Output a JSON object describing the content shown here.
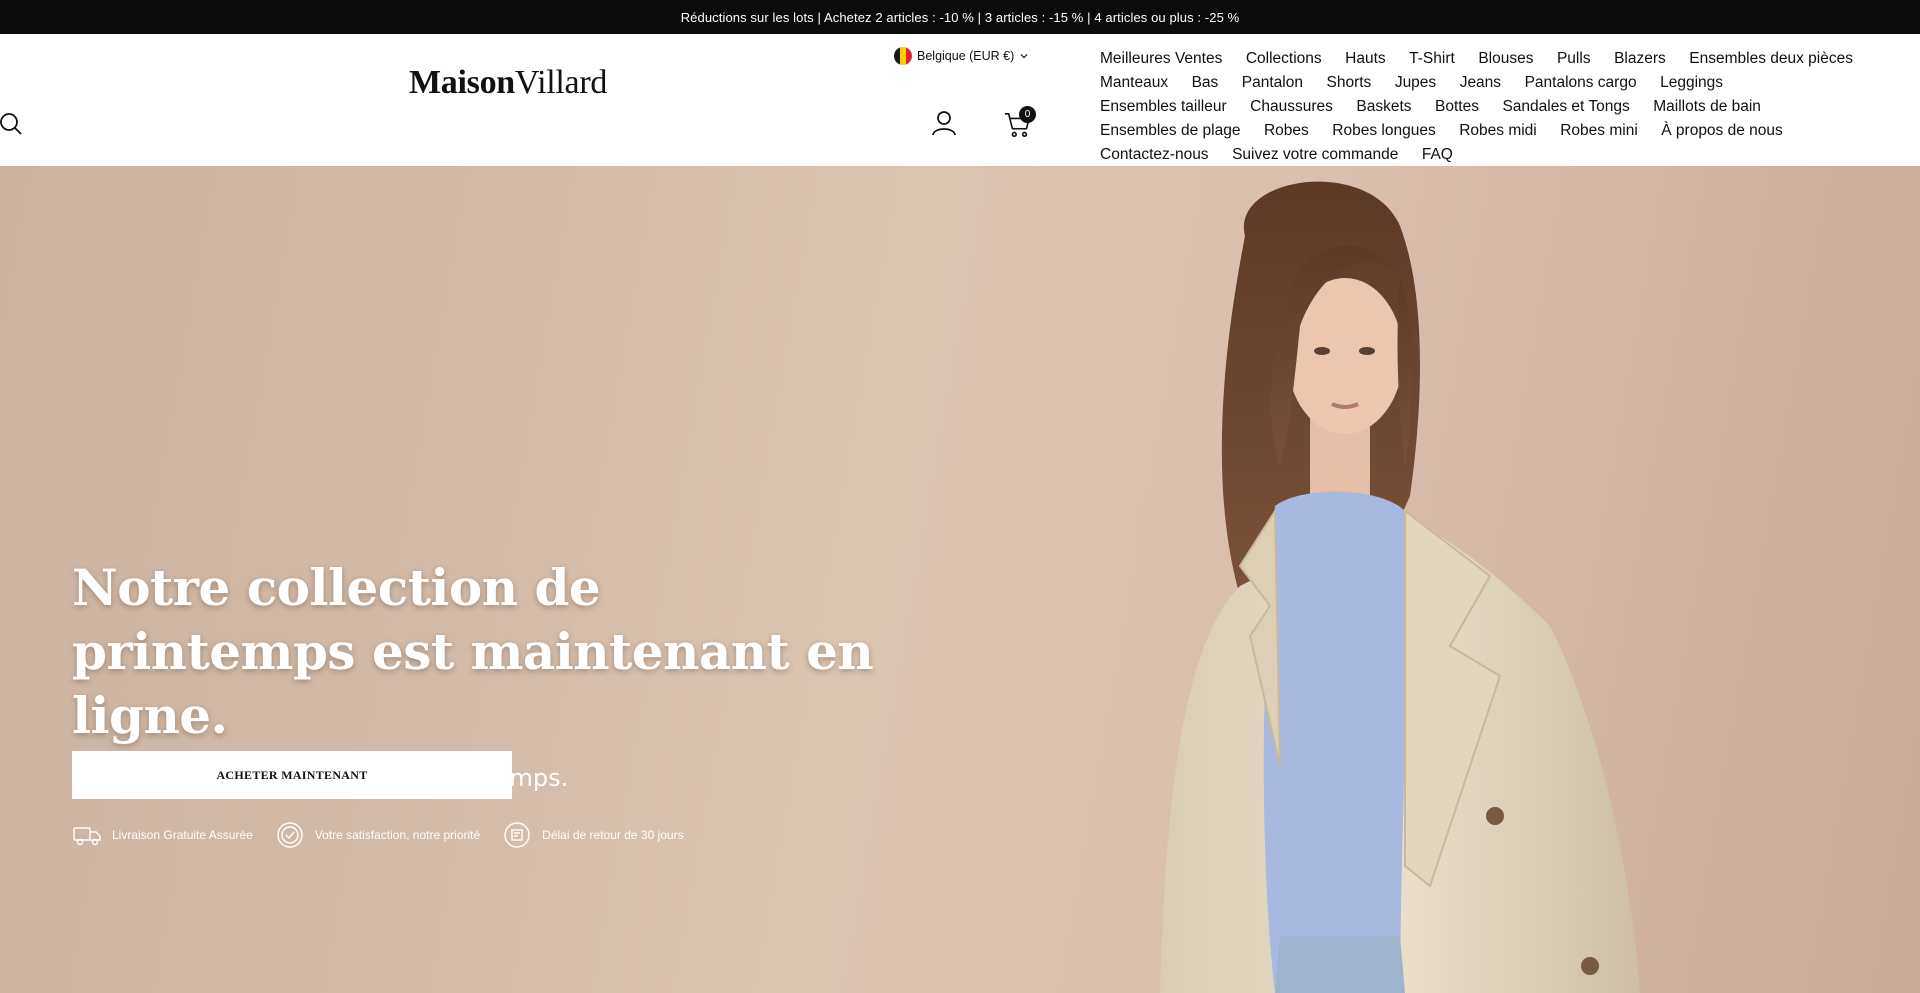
{
  "announcement": "Réductions sur les lots | Achetez 2 articles : -10 % | 3 articles : -15 % | 4 articles ou plus : -25 %",
  "logo": {
    "part1": "Maison",
    "part2": "Villard"
  },
  "country_selector": {
    "label": "Belgique (EUR €)",
    "flag_colors": [
      "#1a1a1a",
      "#f5d000",
      "#e0202b"
    ]
  },
  "cart": {
    "count": "0"
  },
  "nav": {
    "rows": [
      [
        "Meilleures Ventes",
        "Collections",
        "Hauts",
        "T-Shirt",
        "Blouses",
        "Pulls",
        "Blazers",
        "Ensembles deux pièces"
      ],
      [
        "Manteaux",
        "Bas",
        "Pantalon",
        "Shorts",
        "Jupes",
        "Jeans",
        "Pantalons cargo",
        "Leggings"
      ],
      [
        "Ensembles tailleur",
        "Chaussures",
        "Baskets",
        "Bottes",
        "Sandales et Tongs",
        "Maillots de bain"
      ],
      [
        "Ensembles de plage",
        "Robes",
        "Robes longues",
        "Robes midi",
        "Robes mini",
        "À propos de nous"
      ],
      [
        "Contactez-nous",
        "Suivez votre commande",
        "FAQ"
      ]
    ]
  },
  "hero": {
    "title": "Notre collection de printemps est maintenant en ligne.",
    "subtitle": "Découvrez notre collection de printemps.",
    "cta_label": "ACHETER MAINTENANT",
    "usps": [
      {
        "icon": "truck-icon",
        "label": "Livraison Gratuite Assurée"
      },
      {
        "icon": "check-badge-icon",
        "label": "Votre satisfaction, notre priorité"
      },
      {
        "icon": "return-box-icon",
        "label": "Délai de retour de 30 jours"
      }
    ]
  },
  "colors": {
    "announcement_bg": "#0b0b0b",
    "hero_bg": "#d4bca9",
    "text": "#111111"
  }
}
